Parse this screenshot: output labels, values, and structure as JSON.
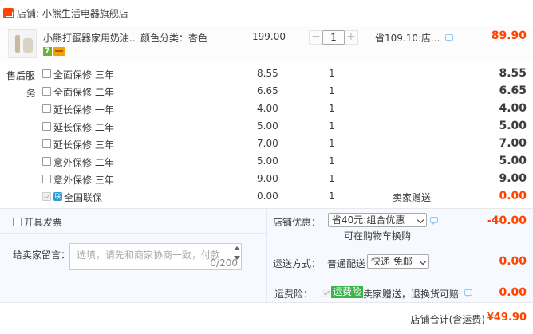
{
  "shop": {
    "label": "店铺: 小熊生活电器旗舰店"
  },
  "item": {
    "title": "小熊打蛋器家用奶油...",
    "sku": "颜色分类：杏色",
    "price": "199.00",
    "quantity": "1",
    "saving": "省109.10:店...",
    "total": "89.90",
    "badge_7": "7"
  },
  "service": {
    "heading_line1": "售后服",
    "heading_line2": "务",
    "rows": [
      {
        "label": "全面保修 三年",
        "price": "8.55",
        "qty": "1",
        "gift": "",
        "total": "8.55"
      },
      {
        "label": "全面保修 二年",
        "price": "6.65",
        "qty": "1",
        "gift": "",
        "total": "6.65"
      },
      {
        "label": "延长保修 一年",
        "price": "4.00",
        "qty": "1",
        "gift": "",
        "total": "4.00"
      },
      {
        "label": "延长保修 二年",
        "price": "5.00",
        "qty": "1",
        "gift": "",
        "total": "5.00"
      },
      {
        "label": "延长保修 三年",
        "price": "7.00",
        "qty": "1",
        "gift": "",
        "total": "7.00"
      },
      {
        "label": "意外保修 二年",
        "price": "5.00",
        "qty": "1",
        "gift": "",
        "total": "5.00"
      },
      {
        "label": "意外保修 三年",
        "price": "9.00",
        "qty": "1",
        "gift": "",
        "total": "9.00"
      },
      {
        "label": "全国联保",
        "price": "0.00",
        "qty": "1",
        "gift": "卖家赠送",
        "total": "0.00"
      }
    ]
  },
  "invoice": {
    "label": "开具发票"
  },
  "message": {
    "label": "给卖家留言：",
    "placeholder": "选填，请先和商家协商一致，付款",
    "counter": "0/200"
  },
  "discount": {
    "label": "店铺优惠：",
    "selected": "省40元:组合优惠",
    "note": "可在购物车换购",
    "total": "-40.00"
  },
  "delivery": {
    "label": "运送方式：",
    "method": "普通配送",
    "selected": "快递 免邮",
    "total": "0.00"
  },
  "insurance": {
    "label": "运费险：",
    "tag": "运费险",
    "text": "卖家赠送，退换货可赔",
    "total": "0.00"
  },
  "footer": {
    "label": "店铺合计(含运费)",
    "total": "¥49.90"
  },
  "colors": {
    "accent": "#ff4400",
    "panel": "#f6f9ff",
    "green": "#3ab54a"
  }
}
